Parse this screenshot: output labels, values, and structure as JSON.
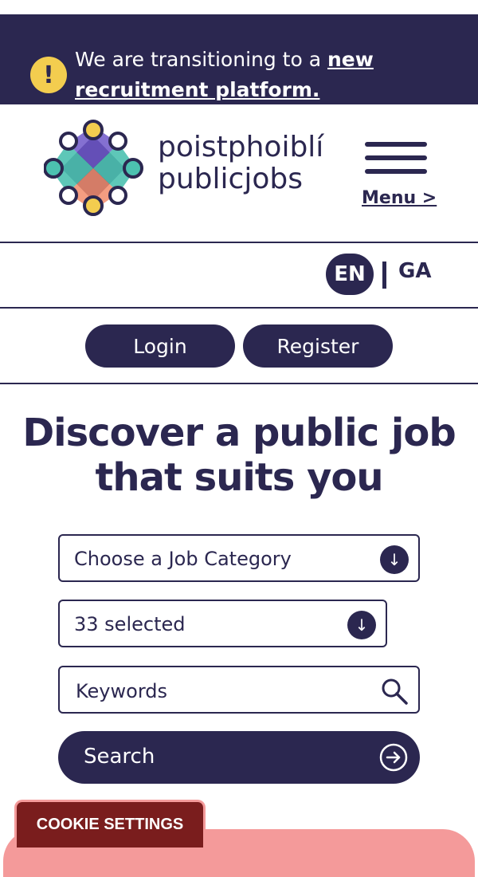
{
  "banner": {
    "icon": "exclamation-icon",
    "text": "We are transitioning to a ",
    "link_text": "new recruitment platform.",
    "background": "#2b2750",
    "icon_color": "#f3cd4f"
  },
  "brand": {
    "name_irish": "poistphoiblí",
    "name_english": "publicjobs",
    "menu_label": "Menu >"
  },
  "language": {
    "active": "EN",
    "inactive": "GA"
  },
  "auth": {
    "login_label": "Login",
    "register_label": "Register"
  },
  "hero": {
    "title": "Discover a public job that suits you"
  },
  "search_form": {
    "category_label": "Choose a Job Category",
    "location_label": "33 selected",
    "keywords_placeholder": "Keywords",
    "search_label": "Search"
  },
  "cookie": {
    "label": "COOKIE SETTINGS"
  },
  "colors": {
    "primary": "#2b2750",
    "cookie": "#7a1d1d",
    "pink": "#f49a9a"
  }
}
